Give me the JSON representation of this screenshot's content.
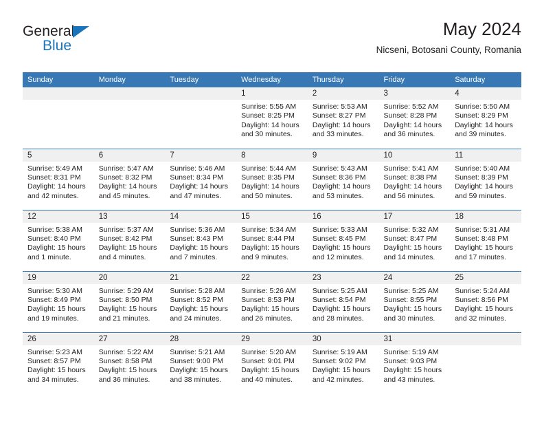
{
  "brand": {
    "name_top": "General",
    "name_bottom": "Blue",
    "triangle_color": "#1b75bb"
  },
  "header": {
    "title": "May 2024",
    "subtitle": "Nicseni, Botosani County, Romania"
  },
  "theme": {
    "header_bg": "#3878b4",
    "daynum_bg": "#f0f0f0",
    "text": "#231f20"
  },
  "weekdays": [
    "Sunday",
    "Monday",
    "Tuesday",
    "Wednesday",
    "Thursday",
    "Friday",
    "Saturday"
  ],
  "weeks": [
    [
      {
        "day": "",
        "empty": true
      },
      {
        "day": "",
        "empty": true
      },
      {
        "day": "",
        "empty": true
      },
      {
        "day": "1",
        "sunrise": "Sunrise: 5:55 AM",
        "sunset": "Sunset: 8:25 PM",
        "daylight_line1": "Daylight: 14 hours",
        "daylight_line2": "and 30 minutes."
      },
      {
        "day": "2",
        "sunrise": "Sunrise: 5:53 AM",
        "sunset": "Sunset: 8:27 PM",
        "daylight_line1": "Daylight: 14 hours",
        "daylight_line2": "and 33 minutes."
      },
      {
        "day": "3",
        "sunrise": "Sunrise: 5:52 AM",
        "sunset": "Sunset: 8:28 PM",
        "daylight_line1": "Daylight: 14 hours",
        "daylight_line2": "and 36 minutes."
      },
      {
        "day": "4",
        "sunrise": "Sunrise: 5:50 AM",
        "sunset": "Sunset: 8:29 PM",
        "daylight_line1": "Daylight: 14 hours",
        "daylight_line2": "and 39 minutes."
      }
    ],
    [
      {
        "day": "5",
        "sunrise": "Sunrise: 5:49 AM",
        "sunset": "Sunset: 8:31 PM",
        "daylight_line1": "Daylight: 14 hours",
        "daylight_line2": "and 42 minutes."
      },
      {
        "day": "6",
        "sunrise": "Sunrise: 5:47 AM",
        "sunset": "Sunset: 8:32 PM",
        "daylight_line1": "Daylight: 14 hours",
        "daylight_line2": "and 45 minutes."
      },
      {
        "day": "7",
        "sunrise": "Sunrise: 5:46 AM",
        "sunset": "Sunset: 8:34 PM",
        "daylight_line1": "Daylight: 14 hours",
        "daylight_line2": "and 47 minutes."
      },
      {
        "day": "8",
        "sunrise": "Sunrise: 5:44 AM",
        "sunset": "Sunset: 8:35 PM",
        "daylight_line1": "Daylight: 14 hours",
        "daylight_line2": "and 50 minutes."
      },
      {
        "day": "9",
        "sunrise": "Sunrise: 5:43 AM",
        "sunset": "Sunset: 8:36 PM",
        "daylight_line1": "Daylight: 14 hours",
        "daylight_line2": "and 53 minutes."
      },
      {
        "day": "10",
        "sunrise": "Sunrise: 5:41 AM",
        "sunset": "Sunset: 8:38 PM",
        "daylight_line1": "Daylight: 14 hours",
        "daylight_line2": "and 56 minutes."
      },
      {
        "day": "11",
        "sunrise": "Sunrise: 5:40 AM",
        "sunset": "Sunset: 8:39 PM",
        "daylight_line1": "Daylight: 14 hours",
        "daylight_line2": "and 59 minutes."
      }
    ],
    [
      {
        "day": "12",
        "sunrise": "Sunrise: 5:38 AM",
        "sunset": "Sunset: 8:40 PM",
        "daylight_line1": "Daylight: 15 hours",
        "daylight_line2": "and 1 minute."
      },
      {
        "day": "13",
        "sunrise": "Sunrise: 5:37 AM",
        "sunset": "Sunset: 8:42 PM",
        "daylight_line1": "Daylight: 15 hours",
        "daylight_line2": "and 4 minutes."
      },
      {
        "day": "14",
        "sunrise": "Sunrise: 5:36 AM",
        "sunset": "Sunset: 8:43 PM",
        "daylight_line1": "Daylight: 15 hours",
        "daylight_line2": "and 7 minutes."
      },
      {
        "day": "15",
        "sunrise": "Sunrise: 5:34 AM",
        "sunset": "Sunset: 8:44 PM",
        "daylight_line1": "Daylight: 15 hours",
        "daylight_line2": "and 9 minutes."
      },
      {
        "day": "16",
        "sunrise": "Sunrise: 5:33 AM",
        "sunset": "Sunset: 8:45 PM",
        "daylight_line1": "Daylight: 15 hours",
        "daylight_line2": "and 12 minutes."
      },
      {
        "day": "17",
        "sunrise": "Sunrise: 5:32 AM",
        "sunset": "Sunset: 8:47 PM",
        "daylight_line1": "Daylight: 15 hours",
        "daylight_line2": "and 14 minutes."
      },
      {
        "day": "18",
        "sunrise": "Sunrise: 5:31 AM",
        "sunset": "Sunset: 8:48 PM",
        "daylight_line1": "Daylight: 15 hours",
        "daylight_line2": "and 17 minutes."
      }
    ],
    [
      {
        "day": "19",
        "sunrise": "Sunrise: 5:30 AM",
        "sunset": "Sunset: 8:49 PM",
        "daylight_line1": "Daylight: 15 hours",
        "daylight_line2": "and 19 minutes."
      },
      {
        "day": "20",
        "sunrise": "Sunrise: 5:29 AM",
        "sunset": "Sunset: 8:50 PM",
        "daylight_line1": "Daylight: 15 hours",
        "daylight_line2": "and 21 minutes."
      },
      {
        "day": "21",
        "sunrise": "Sunrise: 5:28 AM",
        "sunset": "Sunset: 8:52 PM",
        "daylight_line1": "Daylight: 15 hours",
        "daylight_line2": "and 24 minutes."
      },
      {
        "day": "22",
        "sunrise": "Sunrise: 5:26 AM",
        "sunset": "Sunset: 8:53 PM",
        "daylight_line1": "Daylight: 15 hours",
        "daylight_line2": "and 26 minutes."
      },
      {
        "day": "23",
        "sunrise": "Sunrise: 5:25 AM",
        "sunset": "Sunset: 8:54 PM",
        "daylight_line1": "Daylight: 15 hours",
        "daylight_line2": "and 28 minutes."
      },
      {
        "day": "24",
        "sunrise": "Sunrise: 5:25 AM",
        "sunset": "Sunset: 8:55 PM",
        "daylight_line1": "Daylight: 15 hours",
        "daylight_line2": "and 30 minutes."
      },
      {
        "day": "25",
        "sunrise": "Sunrise: 5:24 AM",
        "sunset": "Sunset: 8:56 PM",
        "daylight_line1": "Daylight: 15 hours",
        "daylight_line2": "and 32 minutes."
      }
    ],
    [
      {
        "day": "26",
        "sunrise": "Sunrise: 5:23 AM",
        "sunset": "Sunset: 8:57 PM",
        "daylight_line1": "Daylight: 15 hours",
        "daylight_line2": "and 34 minutes."
      },
      {
        "day": "27",
        "sunrise": "Sunrise: 5:22 AM",
        "sunset": "Sunset: 8:58 PM",
        "daylight_line1": "Daylight: 15 hours",
        "daylight_line2": "and 36 minutes."
      },
      {
        "day": "28",
        "sunrise": "Sunrise: 5:21 AM",
        "sunset": "Sunset: 9:00 PM",
        "daylight_line1": "Daylight: 15 hours",
        "daylight_line2": "and 38 minutes."
      },
      {
        "day": "29",
        "sunrise": "Sunrise: 5:20 AM",
        "sunset": "Sunset: 9:01 PM",
        "daylight_line1": "Daylight: 15 hours",
        "daylight_line2": "and 40 minutes."
      },
      {
        "day": "30",
        "sunrise": "Sunrise: 5:19 AM",
        "sunset": "Sunset: 9:02 PM",
        "daylight_line1": "Daylight: 15 hours",
        "daylight_line2": "and 42 minutes."
      },
      {
        "day": "31",
        "sunrise": "Sunrise: 5:19 AM",
        "sunset": "Sunset: 9:03 PM",
        "daylight_line1": "Daylight: 15 hours",
        "daylight_line2": "and 43 minutes."
      },
      {
        "day": "",
        "empty": true
      }
    ]
  ]
}
